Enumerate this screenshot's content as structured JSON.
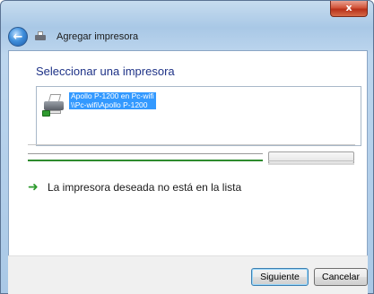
{
  "window": {
    "close_label": "x",
    "title": "Agregar impresora"
  },
  "main": {
    "heading": "Seleccionar una impresora",
    "printers": [
      {
        "name_line1": "Apollo P-1200 en Pc-wifi",
        "name_line2": "\\\\Pc-wifi\\Apollo P-1200",
        "selected": true,
        "icon": "network-printer-icon"
      }
    ],
    "search_progress": 1.0,
    "not_listed_link": "La impresora deseada no está en la lista"
  },
  "footer": {
    "next_label": "Siguiente",
    "cancel_label": "Cancelar"
  },
  "colors": {
    "selection": "#3399ff",
    "heading": "#1e3287",
    "progress": "#2e8b2e"
  }
}
